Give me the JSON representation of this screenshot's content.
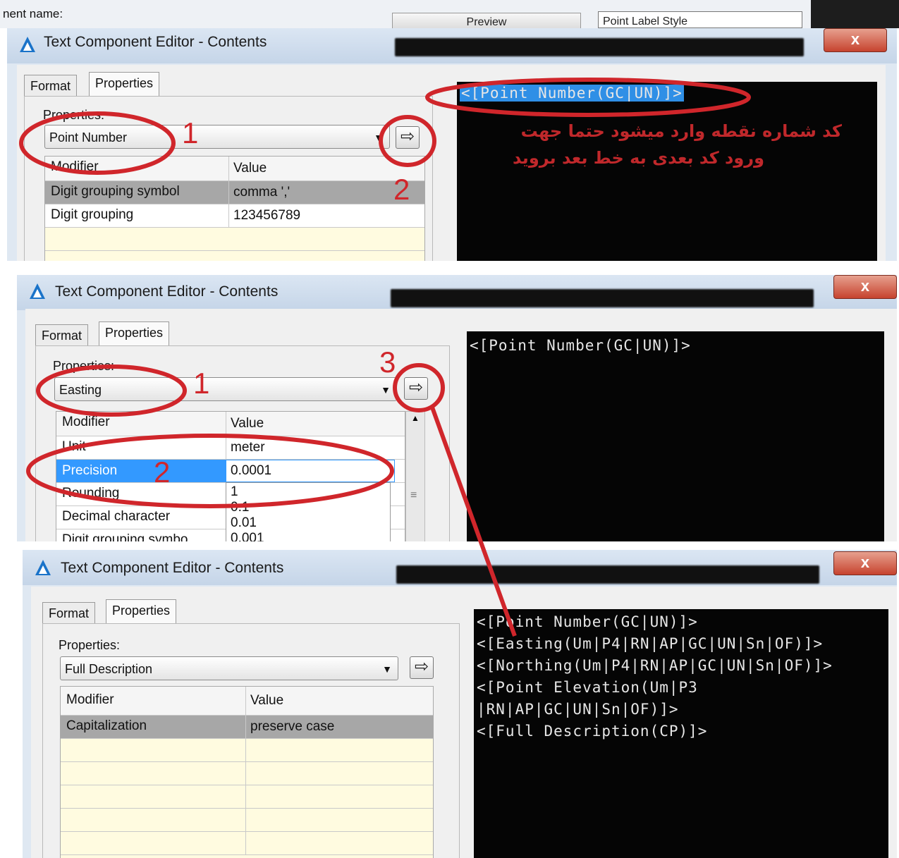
{
  "background": {
    "component_name_label": "nent name:",
    "preview_label": "Preview",
    "style_value": "Point Label Style"
  },
  "dialogs": [
    {
      "title": "Text Component Editor - Contents",
      "close": "x",
      "tabs": [
        "Format",
        "Properties"
      ],
      "properties_label": "Properties:",
      "property_value": "Point Number",
      "columns": [
        "Modifier",
        "Value"
      ],
      "rows": [
        {
          "modifier": "Digit grouping symbol",
          "value": "comma ','"
        },
        {
          "modifier": "Digit grouping",
          "value": "123456789"
        }
      ],
      "code_lines": [
        "<[Point Number(GC|UN)]>"
      ],
      "note_lines": [
        "کد شماره نقطه وارد میشود  حتما جهت",
        "ورود کد بعدی به خط بعد بروید"
      ],
      "markers": [
        "1",
        "2"
      ]
    },
    {
      "title": "Text Component Editor - Contents",
      "close": "x",
      "tabs": [
        "Format",
        "Properties"
      ],
      "properties_label": "Properties:",
      "property_value": "Easting",
      "columns": [
        "Modifier",
        "Value"
      ],
      "rows": [
        {
          "modifier": "Unit",
          "value": "meter"
        },
        {
          "modifier": "Precision",
          "value": "0.0001"
        },
        {
          "modifier": "Rounding",
          "value": "1"
        },
        {
          "modifier": "Decimal character",
          "value": "0.1"
        },
        {
          "modifier": "Digit grouping symbo",
          "value": "0.01"
        }
      ],
      "dropdown_options": [
        "1",
        "0.1",
        "0.01",
        "0.001"
      ],
      "code_lines": [
        "<[Point Number(GC|UN)]>"
      ],
      "markers": [
        "1",
        "2",
        "3"
      ]
    },
    {
      "title": "Text Component Editor - Contents",
      "close": "x",
      "tabs": [
        "Format",
        "Properties"
      ],
      "properties_label": "Properties:",
      "property_value": "Full Description",
      "columns": [
        "Modifier",
        "Value"
      ],
      "rows": [
        {
          "modifier": "Capitalization",
          "value": "preserve case"
        }
      ],
      "code_lines": [
        "<[Point Number(GC|UN)]>",
        "<[Easting(Um|P4|RN|AP|GC|UN|Sn|OF)]>",
        "<[Northing(Um|P4|RN|AP|GC|UN|Sn|OF)]>",
        "<[Point Elevation(Um|P3",
        "|RN|AP|GC|UN|Sn|OF)]>",
        "<[Full Description(CP)]>"
      ]
    }
  ],
  "icons": {
    "app_logo": "autocad-civil-icon",
    "insert_arrow": "arrow-right-icon",
    "dropdown": "chevron-down-icon"
  },
  "colors": {
    "annotation_red": "#d0262b",
    "selection_blue": "#3399ff",
    "code_bg": "#050505"
  }
}
